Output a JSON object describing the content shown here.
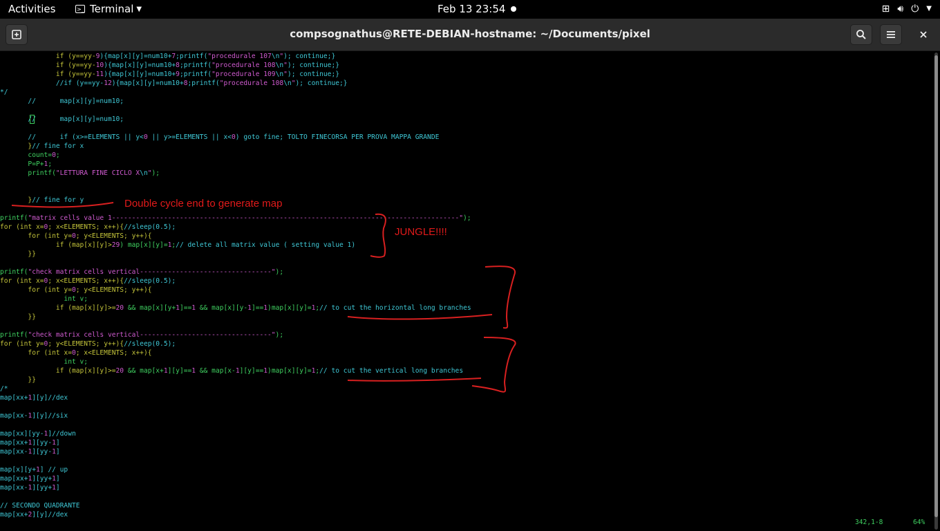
{
  "topbar": {
    "activities": "Activities",
    "app_name": "Terminal",
    "clock": "Feb 13  23:54"
  },
  "window": {
    "title": "compsognathus@RETE-DEBIAN-hostname: ~/Documents/pixel"
  },
  "code_lines": [
    [
      {
        "t": "              if (y==yy-",
        "c": "y"
      },
      {
        "t": "9",
        "c": "m"
      },
      {
        "t": "){map[x][y]=num10+",
        "c": "c"
      },
      {
        "t": "7",
        "c": "m"
      },
      {
        "t": ";printf(",
        "c": "c"
      },
      {
        "t": "\"procedurale 107",
        "c": "m"
      },
      {
        "t": "\\n",
        "c": "c"
      },
      {
        "t": "\"",
        "c": "m"
      },
      {
        "t": "); continue;}",
        "c": "c"
      }
    ],
    [
      {
        "t": "              if (y==yy-",
        "c": "y"
      },
      {
        "t": "10",
        "c": "m"
      },
      {
        "t": "){map[x][y]=num10+",
        "c": "c"
      },
      {
        "t": "8",
        "c": "m"
      },
      {
        "t": ";printf(",
        "c": "c"
      },
      {
        "t": "\"procedurale 108",
        "c": "m"
      },
      {
        "t": "\\n",
        "c": "c"
      },
      {
        "t": "\"",
        "c": "m"
      },
      {
        "t": "); continue;}",
        "c": "c"
      }
    ],
    [
      {
        "t": "              if (y==yy-",
        "c": "y"
      },
      {
        "t": "11",
        "c": "m"
      },
      {
        "t": "){map[x][y]=num10+",
        "c": "c"
      },
      {
        "t": "9",
        "c": "m"
      },
      {
        "t": ";printf(",
        "c": "c"
      },
      {
        "t": "\"procedurale 109",
        "c": "m"
      },
      {
        "t": "\\n",
        "c": "c"
      },
      {
        "t": "\"",
        "c": "m"
      },
      {
        "t": "); continue;}",
        "c": "c"
      }
    ],
    [
      {
        "t": "              //if (y==yy-",
        "c": "c"
      },
      {
        "t": "12",
        "c": "m"
      },
      {
        "t": "){map[x][y]=num10+",
        "c": "c"
      },
      {
        "t": "8",
        "c": "m"
      },
      {
        "t": ";printf(",
        "c": "c"
      },
      {
        "t": "\"procedurale 108",
        "c": "m"
      },
      {
        "t": "\\n",
        "c": "c"
      },
      {
        "t": "\"",
        "c": "m"
      },
      {
        "t": "); continue;}",
        "c": "c"
      }
    ],
    [
      {
        "t": "*/",
        "c": "c"
      }
    ],
    [
      {
        "t": "       //      map[x][y]=num10;",
        "c": "c"
      }
    ],
    [
      {
        "t": "",
        "c": "c"
      }
    ],
    [
      {
        "t": "       //      map[x][y]=num10;",
        "c": "c"
      }
    ],
    [
      {
        "t": "",
        "c": "c"
      }
    ],
    [
      {
        "t": "       //      if (x>=ELEMENTS || y<",
        "c": "c"
      },
      {
        "t": "0",
        "c": "m"
      },
      {
        "t": " || y>=ELEMENTS || x<",
        "c": "c"
      },
      {
        "t": "0",
        "c": "m"
      },
      {
        "t": ") goto fine; TOLTO FINECORSA PER PROVA MAPPA GRANDE",
        "c": "c"
      }
    ],
    [
      {
        "t": "       }",
        "c": "y"
      },
      {
        "t": "// fine for x",
        "c": "c"
      }
    ],
    [
      {
        "t": "       count=",
        "c": "g"
      },
      {
        "t": "0",
        "c": "m"
      },
      {
        "t": ";",
        "c": "g"
      }
    ],
    [
      {
        "t": "       P=P+",
        "c": "g"
      },
      {
        "t": "1",
        "c": "m"
      },
      {
        "t": ";",
        "c": "g"
      }
    ],
    [
      {
        "t": "       printf(",
        "c": "g"
      },
      {
        "t": "\"LETTURA FINE CICLO X",
        "c": "m"
      },
      {
        "t": "\\n",
        "c": "c"
      },
      {
        "t": "\"",
        "c": "m"
      },
      {
        "t": ");",
        "c": "g"
      }
    ],
    [
      {
        "t": "",
        "c": "c"
      }
    ],
    [
      {
        "t": "",
        "c": "c"
      }
    ],
    [
      {
        "t": "       }",
        "c": "y"
      },
      {
        "t": "// fine for y",
        "c": "c"
      }
    ],
    [
      {
        "t": "",
        "c": "c"
      }
    ],
    [
      {
        "t": "printf(",
        "c": "g"
      },
      {
        "t": "\"matrix cells value 1---------------------------------------------------------------------------------------\"",
        "c": "m"
      },
      {
        "t": ");",
        "c": "g"
      }
    ],
    [
      {
        "t": "for (int x=",
        "c": "y"
      },
      {
        "t": "0",
        "c": "m"
      },
      {
        "t": "; x<ELEMENTS; x++){",
        "c": "y"
      },
      {
        "t": "//sleep(0.5);",
        "c": "c"
      }
    ],
    [
      {
        "t": "       for (int y=",
        "c": "y"
      },
      {
        "t": "0",
        "c": "m"
      },
      {
        "t": "; y<ELEMENTS; y++){",
        "c": "y"
      }
    ],
    [
      {
        "t": "              if (map[x][y]>",
        "c": "y"
      },
      {
        "t": "29",
        "c": "m"
      },
      {
        "t": ") map[x][y]=",
        "c": "g"
      },
      {
        "t": "1",
        "c": "m"
      },
      {
        "t": ";",
        "c": "g"
      },
      {
        "t": "// delete all matrix value ( setting value 1)",
        "c": "c"
      }
    ],
    [
      {
        "t": "       }}",
        "c": "y"
      }
    ],
    [
      {
        "t": "",
        "c": "c"
      }
    ],
    [
      {
        "t": "printf(",
        "c": "g"
      },
      {
        "t": "\"check matrix cells vertical---------------------------------\"",
        "c": "m"
      },
      {
        "t": ");",
        "c": "g"
      }
    ],
    [
      {
        "t": "for (int x=",
        "c": "y"
      },
      {
        "t": "0",
        "c": "m"
      },
      {
        "t": "; x<ELEMENTS; x++){",
        "c": "y"
      },
      {
        "t": "//sleep(0.5);",
        "c": "c"
      }
    ],
    [
      {
        "t": "       for (int y=",
        "c": "y"
      },
      {
        "t": "0",
        "c": "m"
      },
      {
        "t": "; y<ELEMENTS; y++){",
        "c": "y"
      }
    ],
    [
      {
        "t": "                int v;",
        "c": "g"
      }
    ],
    [
      {
        "t": "              if (map[x][y]>=",
        "c": "y"
      },
      {
        "t": "20",
        "c": "m"
      },
      {
        "t": " && map[x][y+",
        "c": "g"
      },
      {
        "t": "1",
        "c": "m"
      },
      {
        "t": "]==",
        "c": "g"
      },
      {
        "t": "1",
        "c": "m"
      },
      {
        "t": " && map[x][y-",
        "c": "g"
      },
      {
        "t": "1",
        "c": "m"
      },
      {
        "t": "]==",
        "c": "g"
      },
      {
        "t": "1",
        "c": "m"
      },
      {
        "t": ")map[x][y]=",
        "c": "g"
      },
      {
        "t": "1",
        "c": "m"
      },
      {
        "t": ";",
        "c": "g"
      },
      {
        "t": "// to cut the horizontal long branches",
        "c": "c"
      }
    ],
    [
      {
        "t": "       }}",
        "c": "y"
      }
    ],
    [
      {
        "t": "",
        "c": "c"
      }
    ],
    [
      {
        "t": "printf(",
        "c": "g"
      },
      {
        "t": "\"check matrix cells vertical---------------------------------\"",
        "c": "m"
      },
      {
        "t": ");",
        "c": "g"
      }
    ],
    [
      {
        "t": "for (int y=",
        "c": "y"
      },
      {
        "t": "0",
        "c": "m"
      },
      {
        "t": "; y<ELEMENTS; y++){",
        "c": "y"
      },
      {
        "t": "//sleep(0.5);",
        "c": "c"
      }
    ],
    [
      {
        "t": "       for (int x=",
        "c": "y"
      },
      {
        "t": "0",
        "c": "m"
      },
      {
        "t": "; x<ELEMENTS; x++){",
        "c": "y"
      }
    ],
    [
      {
        "t": "                int v;",
        "c": "g"
      }
    ],
    [
      {
        "t": "              if (map[x][y]>=",
        "c": "y"
      },
      {
        "t": "20",
        "c": "m"
      },
      {
        "t": " && map[x+",
        "c": "g"
      },
      {
        "t": "1",
        "c": "m"
      },
      {
        "t": "][y]==",
        "c": "g"
      },
      {
        "t": "1",
        "c": "m"
      },
      {
        "t": " && map[x-",
        "c": "g"
      },
      {
        "t": "1",
        "c": "m"
      },
      {
        "t": "][y]==",
        "c": "g"
      },
      {
        "t": "1",
        "c": "m"
      },
      {
        "t": ")map[x][y]=",
        "c": "g"
      },
      {
        "t": "1",
        "c": "m"
      },
      {
        "t": ";",
        "c": "g"
      },
      {
        "t": "// to cut the vertical long branches",
        "c": "c"
      }
    ],
    [
      {
        "t": "       }}",
        "c": "y"
      }
    ],
    [
      {
        "t": "/*",
        "c": "c"
      }
    ],
    [
      {
        "t": "map[xx+",
        "c": "c"
      },
      {
        "t": "1",
        "c": "m"
      },
      {
        "t": "][y]//dex",
        "c": "c"
      }
    ],
    [
      {
        "t": "",
        "c": "c"
      }
    ],
    [
      {
        "t": "map[xx-",
        "c": "c"
      },
      {
        "t": "1",
        "c": "m"
      },
      {
        "t": "][y]//six",
        "c": "c"
      }
    ],
    [
      {
        "t": "",
        "c": "c"
      }
    ],
    [
      {
        "t": "map[xx][yy-",
        "c": "c"
      },
      {
        "t": "1",
        "c": "m"
      },
      {
        "t": "]//down",
        "c": "c"
      }
    ],
    [
      {
        "t": "map[xx+",
        "c": "c"
      },
      {
        "t": "1",
        "c": "m"
      },
      {
        "t": "][yy-",
        "c": "c"
      },
      {
        "t": "1",
        "c": "m"
      },
      {
        "t": "]",
        "c": "c"
      }
    ],
    [
      {
        "t": "map[xx-",
        "c": "c"
      },
      {
        "t": "1",
        "c": "m"
      },
      {
        "t": "][yy-",
        "c": "c"
      },
      {
        "t": "1",
        "c": "m"
      },
      {
        "t": "]",
        "c": "c"
      }
    ],
    [
      {
        "t": "",
        "c": "c"
      }
    ],
    [
      {
        "t": "map[x][y+",
        "c": "c"
      },
      {
        "t": "1",
        "c": "m"
      },
      {
        "t": "] // up",
        "c": "c"
      }
    ],
    [
      {
        "t": "map[xx+",
        "c": "c"
      },
      {
        "t": "1",
        "c": "m"
      },
      {
        "t": "][yy+",
        "c": "c"
      },
      {
        "t": "1",
        "c": "m"
      },
      {
        "t": "]",
        "c": "c"
      }
    ],
    [
      {
        "t": "map[xx-",
        "c": "c"
      },
      {
        "t": "1",
        "c": "m"
      },
      {
        "t": "][yy+",
        "c": "c"
      },
      {
        "t": "1",
        "c": "m"
      },
      {
        "t": "]",
        "c": "c"
      }
    ],
    [
      {
        "t": "",
        "c": "c"
      }
    ],
    [
      {
        "t": "// SECONDO QUADRANTE",
        "c": "c"
      }
    ],
    [
      {
        "t": "map[xx+",
        "c": "c"
      },
      {
        "t": "2",
        "c": "m"
      },
      {
        "t": "][y]//dex",
        "c": "c"
      }
    ]
  ],
  "status": {
    "position": "342,1-8",
    "percent": "64%"
  },
  "annotations": {
    "cycle_note": "Double cycle end to generate map",
    "jungle_note": "JUNGLE!!!!"
  },
  "colors": {
    "comment": "#3fc8d6",
    "keyword": "#c4c43a",
    "string": "#d05bd0",
    "code": "#3fd060",
    "annotation": "#e21a1a"
  }
}
